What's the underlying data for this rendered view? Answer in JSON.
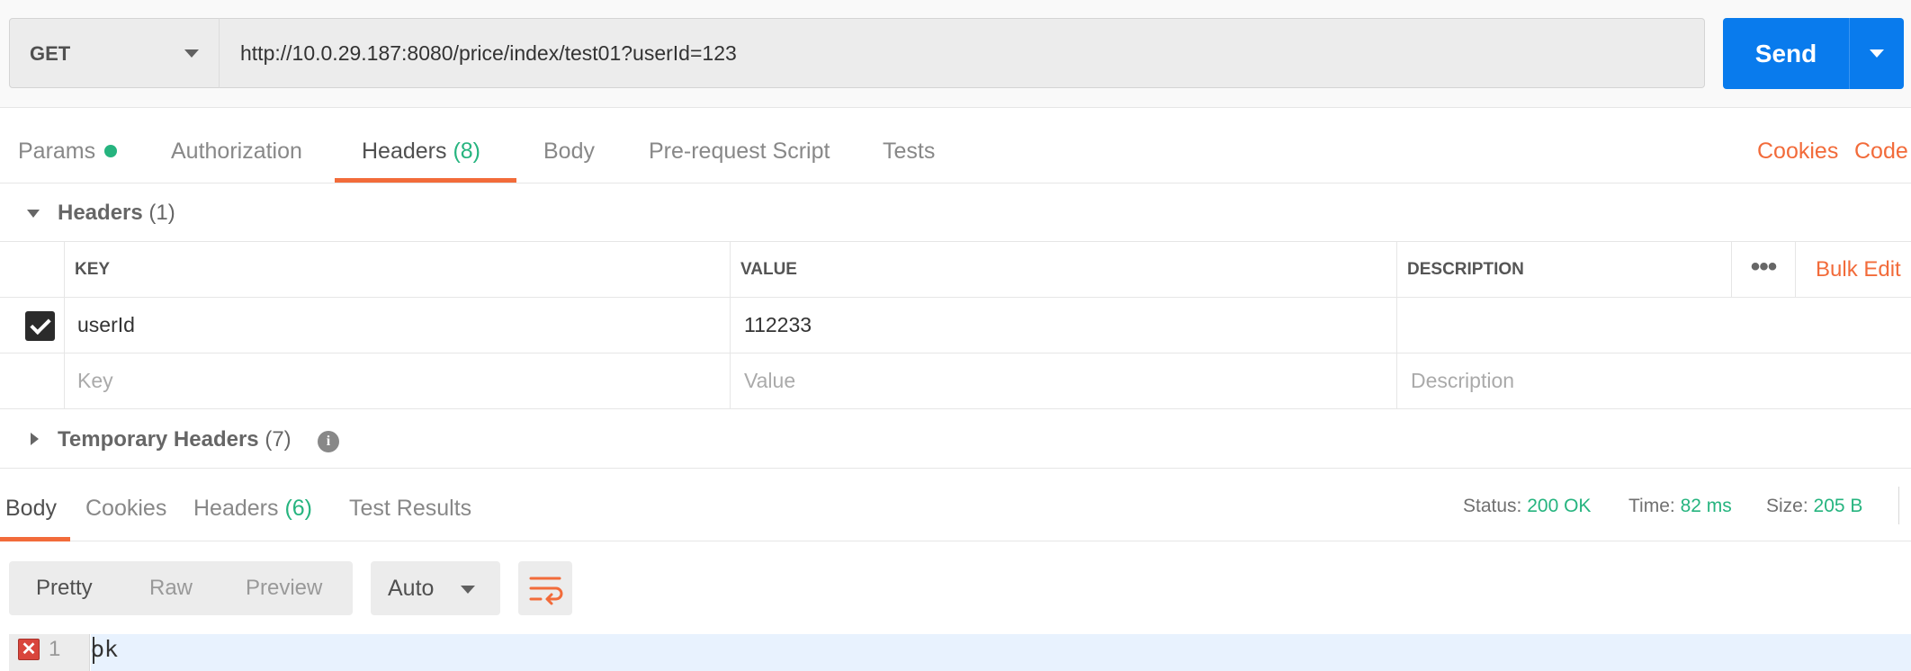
{
  "request": {
    "method": "GET",
    "url": "http://10.0.29.187:8080/price/index/test01?userId=123",
    "send_label": "Send"
  },
  "request_tabs": {
    "params": "Params",
    "authorization": "Authorization",
    "headers": "Headers",
    "headers_count": "(8)",
    "body": "Body",
    "prerequest": "Pre-request Script",
    "tests": "Tests",
    "cookies_link": "Cookies",
    "code_link": "Code"
  },
  "headers_section": {
    "title": "Headers",
    "count": "(1)",
    "columns": {
      "key": "KEY",
      "value": "VALUE",
      "description": "DESCRIPTION"
    },
    "bulk_edit": "Bulk Edit",
    "more": "•••",
    "rows": [
      {
        "enabled": true,
        "key": "userId",
        "value": "112233",
        "description": ""
      }
    ],
    "placeholders": {
      "key": "Key",
      "value": "Value",
      "description": "Description"
    }
  },
  "temporary_headers": {
    "title": "Temporary Headers",
    "count": "(7)",
    "info": "i"
  },
  "response_tabs": {
    "body": "Body",
    "cookies": "Cookies",
    "headers": "Headers",
    "headers_count": "(6)",
    "test_results": "Test Results"
  },
  "response_status": {
    "status_label": "Status:",
    "status_value": "200 OK",
    "time_label": "Time:",
    "time_value": "82 ms",
    "size_label": "Size:",
    "size_value": "205 B"
  },
  "response_view": {
    "pretty": "Pretty",
    "raw": "Raw",
    "preview": "Preview",
    "format": "Auto"
  },
  "response_body": {
    "lines": [
      {
        "number": "1",
        "text": "ok",
        "has_error": true
      }
    ],
    "error_glyph": "✕"
  },
  "colors": {
    "accent_orange": "#f26b3a",
    "send_blue": "#097bed",
    "status_green": "#26b47f"
  },
  "icons": {
    "method_dropdown": "chevron-down-icon",
    "send_dropdown": "chevron-down-icon",
    "wrap": "wrap-lines-icon",
    "info": "info-icon",
    "error": "error-icon",
    "check": "check-icon"
  }
}
